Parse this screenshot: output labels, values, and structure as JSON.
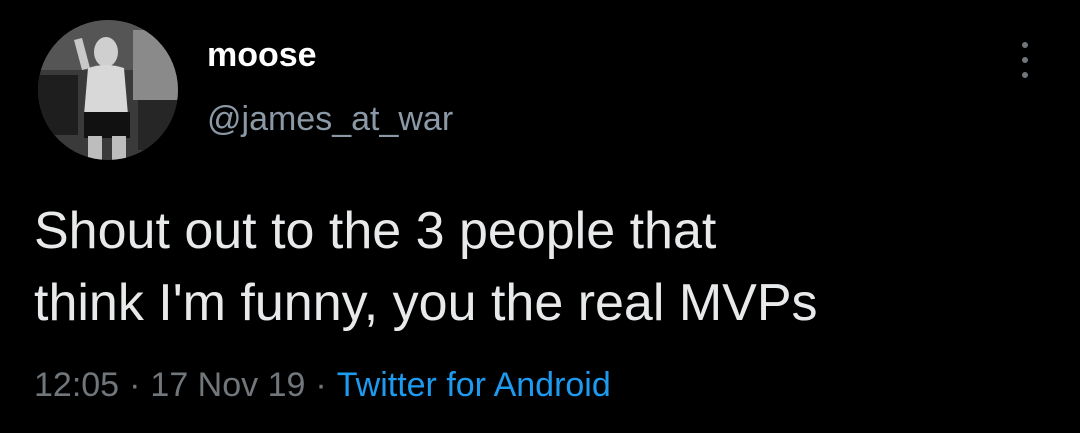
{
  "tweet": {
    "author": {
      "display_name": "moose",
      "handle": "@james_at_war",
      "avatar_icon": "profile-photo"
    },
    "more_icon": "more-vertical-icon",
    "text_lines": [
      "Shout out to the 3 people that",
      "think I'm funny, you the real MVPs"
    ],
    "time": "12:05",
    "date": "17 Nov 19",
    "separator": "·",
    "source": "Twitter for Android"
  },
  "colors": {
    "background": "#000000",
    "name": "#ffffff",
    "handle": "#8b98a5",
    "body_text": "#e7e9ea",
    "meta": "#71767b",
    "link": "#1d9bf0"
  }
}
